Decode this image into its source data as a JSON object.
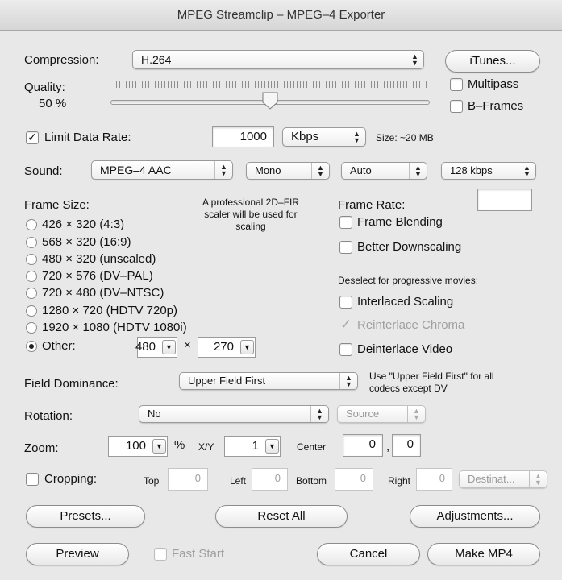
{
  "window": {
    "title": "MPEG Streamclip – MPEG–4 Exporter"
  },
  "compression": {
    "label": "Compression:",
    "value": "H.264",
    "itunes_button": "iTunes..."
  },
  "quality": {
    "label": "Quality:",
    "value_text": "50 %",
    "level": 0.5
  },
  "multipass": {
    "label": "Multipass",
    "checked": false
  },
  "bframes": {
    "label": "B–Frames",
    "checked": false
  },
  "limit_data_rate": {
    "label": "Limit Data Rate:",
    "checked": true,
    "value": "1000",
    "unit": "Kbps",
    "size_text": "Size: ~20 MB"
  },
  "sound": {
    "label": "Sound:",
    "codec": "MPEG–4 AAC",
    "channels": "Mono",
    "rate": "Auto",
    "bitrate": "128 kbps"
  },
  "frame_size": {
    "label": "Frame Size:",
    "note": [
      "A professional 2D–FIR",
      "scaler will be used for",
      "scaling"
    ],
    "options": [
      "426 × 320  (4:3)",
      "568 × 320  (16:9)",
      "480 × 320  (unscaled)",
      "720 × 576  (DV–PAL)",
      "720 × 480  (DV–NTSC)",
      "1280 × 720  (HDTV 720p)",
      "1920 × 1080  (HDTV 1080i)"
    ],
    "other_label": "Other:",
    "other_width": "480",
    "times": "×",
    "other_height": "270",
    "selected": "other"
  },
  "frame_rate": {
    "label": "Frame Rate:",
    "value": ""
  },
  "frame_blending": {
    "label": "Frame Blending",
    "checked": false
  },
  "better_downscaling": {
    "label": "Better Downscaling",
    "checked": false
  },
  "deselect_note": "Deselect for progressive movies:",
  "interlaced_scaling": {
    "label": "Interlaced Scaling",
    "checked": false
  },
  "reinterlace_chroma": {
    "label": "Reinterlace Chroma",
    "checked": true,
    "enabled": false
  },
  "deinterlace_video": {
    "label": "Deinterlace Video",
    "checked": false
  },
  "field_dominance": {
    "label": "Field Dominance:",
    "value": "Upper Field First",
    "note": [
      "Use \"Upper Field First\" for all",
      "codecs except DV"
    ]
  },
  "rotation": {
    "label": "Rotation:",
    "value": "No",
    "source": "Source"
  },
  "zoom": {
    "label": "Zoom:",
    "value": "100",
    "percent": "%",
    "xy_label": "X/Y",
    "xy_value": "1",
    "center_label": "Center",
    "center_x": "0",
    "comma": ",",
    "center_y": "0"
  },
  "cropping": {
    "label": "Cropping:",
    "checked": false,
    "top_label": "Top",
    "top": "0",
    "left_label": "Left",
    "left": "0",
    "bottom_label": "Bottom",
    "bottom": "0",
    "right_label": "Right",
    "right": "0",
    "destination": "Destinat..."
  },
  "buttons": {
    "presets": "Presets...",
    "reset_all": "Reset All",
    "adjustments": "Adjustments...",
    "preview": "Preview",
    "cancel": "Cancel",
    "make_mp4": "Make MP4"
  },
  "fast_start": {
    "label": "Fast Start",
    "checked": false,
    "enabled": false
  }
}
